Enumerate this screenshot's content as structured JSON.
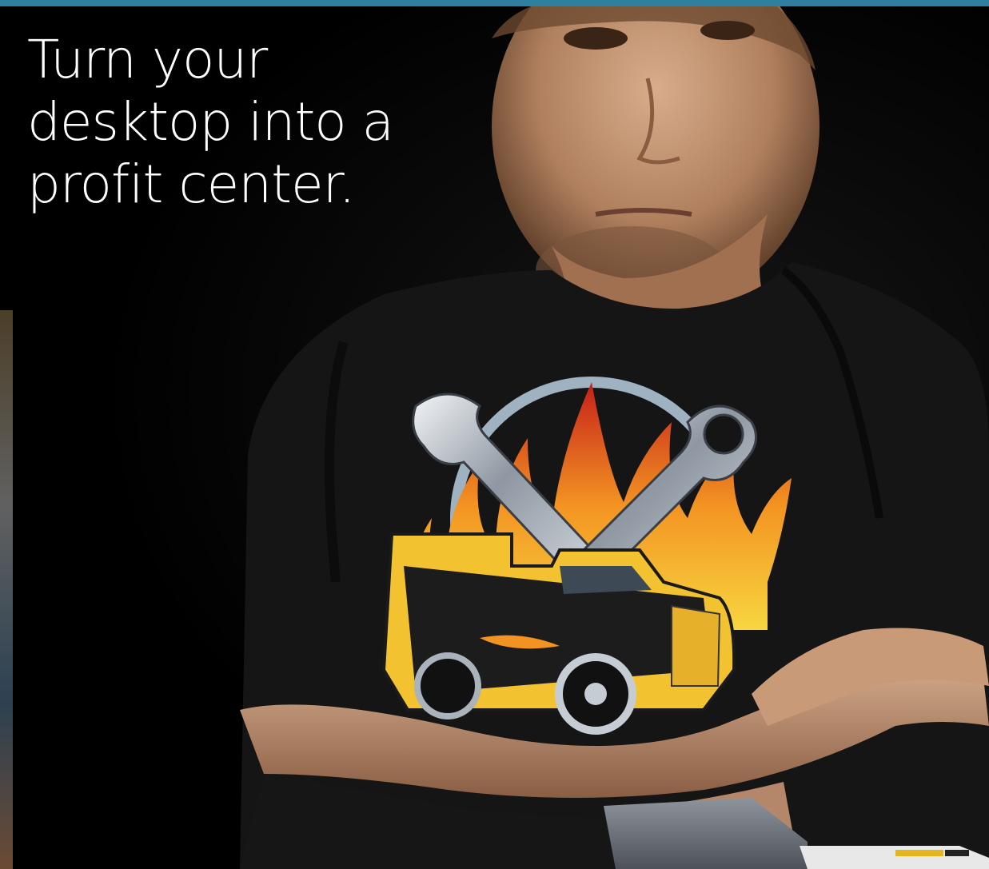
{
  "headline": {
    "line1": "Turn your",
    "line2": "desktop into a",
    "line3": "profit center."
  },
  "colors": {
    "accent_bar": "#2e7fa0",
    "background": "#000000",
    "headline_text": "#ffffff",
    "shirt": "#141414",
    "skin": "#c69a7a",
    "flame_outer": "#d8301c",
    "flame_inner": "#f7b531",
    "truck_yellow": "#f2c230"
  },
  "image": {
    "subject": "man-with-crossed-arms",
    "shirt_graphic": "tow-truck-with-wrenches-and-flames",
    "foreground_object": "desktop-printer"
  }
}
